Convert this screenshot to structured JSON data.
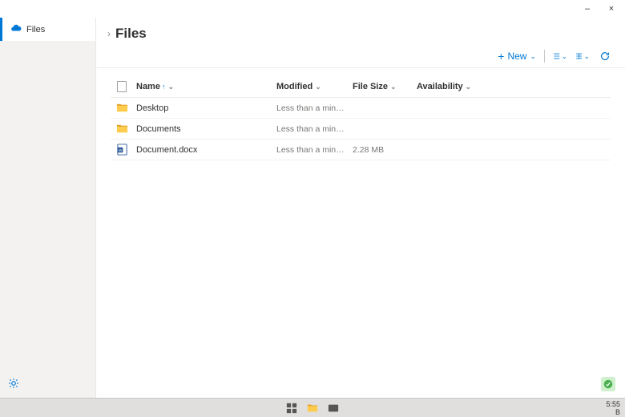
{
  "window": {
    "minimize": "–",
    "close": "×"
  },
  "sidebar": {
    "title": "Files"
  },
  "header": {
    "title": "Files"
  },
  "toolbar": {
    "new": "New"
  },
  "columns": {
    "name": "Name",
    "modified": "Modified",
    "size": "File Size",
    "availability": "Availability"
  },
  "rows": [
    {
      "type": "folder",
      "name": "Desktop",
      "modified": "Less than a minute ago",
      "size": "",
      "availability": ""
    },
    {
      "type": "folder",
      "name": "Documents",
      "modified": "Less than a minute ago",
      "size": "",
      "availability": ""
    },
    {
      "type": "docx",
      "name": "Document.docx",
      "modified": "Less than a minute ago",
      "size": "2.28 MB",
      "availability": ""
    }
  ],
  "clock": {
    "time": "5:55",
    "extra": "B"
  }
}
